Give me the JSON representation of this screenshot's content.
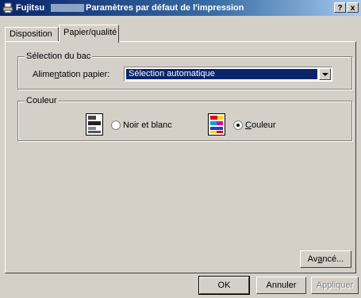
{
  "window": {
    "app_name": "Fujitsu",
    "title": "Paramètres par défaut de l'impression",
    "help_button": "?",
    "close_button": "x"
  },
  "tabs": [
    {
      "label": "Disposition",
      "active": false
    },
    {
      "label": "Papier/qualité",
      "active": true
    }
  ],
  "tray_group": {
    "legend": "Sélection du bac",
    "paper_source_label": "Alimentation papier:",
    "paper_source_value": "Sélection automatique"
  },
  "color_group": {
    "legend": "Couleur",
    "bw_option_label": "Noir et blanc",
    "color_option_label": "Couleur",
    "selected": "Couleur"
  },
  "buttons": {
    "advanced": "Avancé...",
    "ok": "OK",
    "cancel": "Annuler",
    "apply": "Appliquer"
  }
}
